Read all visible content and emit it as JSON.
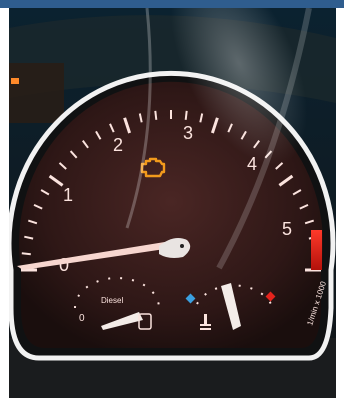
{
  "photo": {
    "subject": "car-instrument-cluster-tachometer",
    "tachometer": {
      "scale_labels": [
        "0",
        "1",
        "2",
        "3",
        "4",
        "5"
      ],
      "unit_label": "1/min x 1000",
      "needle_reading": 0.4,
      "redline_start": 5
    },
    "fuel_gauge": {
      "label": "Diesel",
      "empty_mark": "0",
      "level": 0.2
    },
    "temp_gauge": {
      "level": 0.35
    },
    "warning_light": {
      "name": "check-engine-icon",
      "color": "#f29a1c"
    },
    "colors": {
      "dial_face": "#3a1e1c",
      "bezel": "#f2f2f2",
      "redline": "#e3231c",
      "numbers": "#fbe3de",
      "cold_marker": "#3aa0e0",
      "hot_marker": "#e3231c",
      "top_bar": "#2f5d8e"
    }
  }
}
